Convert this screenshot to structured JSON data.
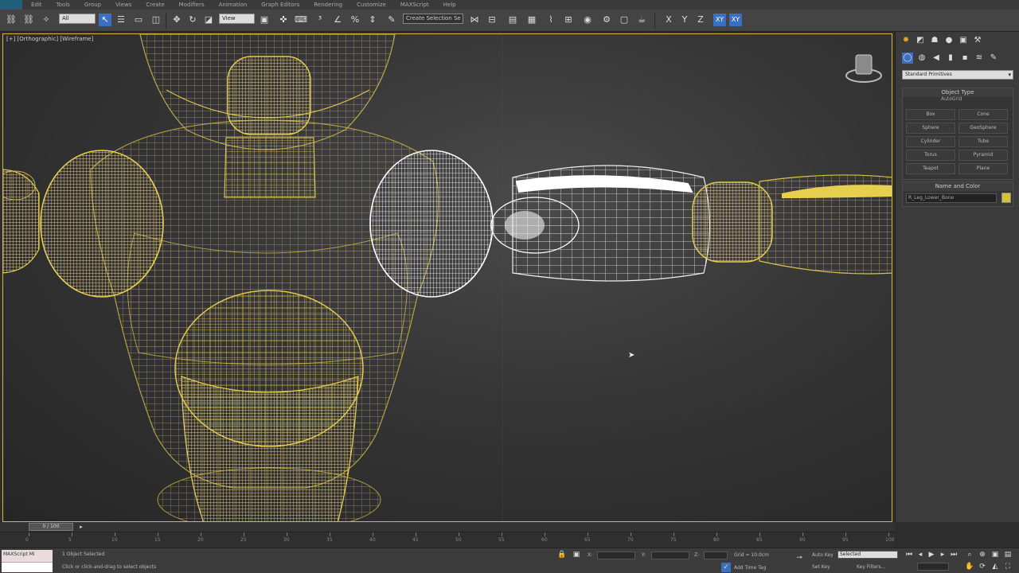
{
  "menu": {
    "items": [
      "Edit",
      "Tools",
      "Group",
      "Views",
      "Create",
      "Modifiers",
      "Animation",
      "Graph Editors",
      "Rendering",
      "Customize",
      "MAXScript",
      "Help"
    ]
  },
  "toolbar": {
    "selection_filter": "All",
    "reference_coord": "View",
    "named_selection": "Create Selection Se",
    "axis_x": "X",
    "axis_y": "Y",
    "axis_z": "Z",
    "axis_xy": "XY",
    "axis_xy2": "XY"
  },
  "viewport": {
    "label": "[+] [Orthographic] [Wireframe]"
  },
  "command_panel": {
    "category": "Standard Primitives",
    "object_type": {
      "title": "Object Type",
      "autogrid": "AutoGrid",
      "buttons": [
        "Box",
        "Cone",
        "Sphere",
        "GeoSphere",
        "Cylinder",
        "Tube",
        "Torus",
        "Pyramid",
        "Teapot",
        "Plane"
      ]
    },
    "name_color": {
      "title": "Name and Color",
      "name": "R_Leg_Lower_Bone",
      "color": "#d4c23c"
    }
  },
  "timeline": {
    "frame": "0 / 100",
    "ticks": [
      "0",
      "5",
      "10",
      "15",
      "20",
      "25",
      "30",
      "35",
      "40",
      "45",
      "50",
      "55",
      "60",
      "65",
      "70",
      "75",
      "80",
      "85",
      "90",
      "95",
      "100"
    ]
  },
  "status": {
    "maxscript": "MAXScript Mi",
    "selected": "1 Object Selected",
    "prompt": "Click or click-and-drag to select objects",
    "x_label": "X:",
    "y_label": "Y:",
    "z_label": "Z:",
    "grid": "Grid = 10.0cm",
    "auto_key": "Auto Key",
    "set_key": "Set Key",
    "key_mode": "Selected",
    "key_filters": "Key Filters...",
    "add_time_tag": "Add Time Tag"
  },
  "colors": {
    "selected_wire": "#d8c24a",
    "highlight_wire": "#ffffff",
    "viewport_border": "#d8b73a",
    "active_axis": "#3b6fbf"
  }
}
